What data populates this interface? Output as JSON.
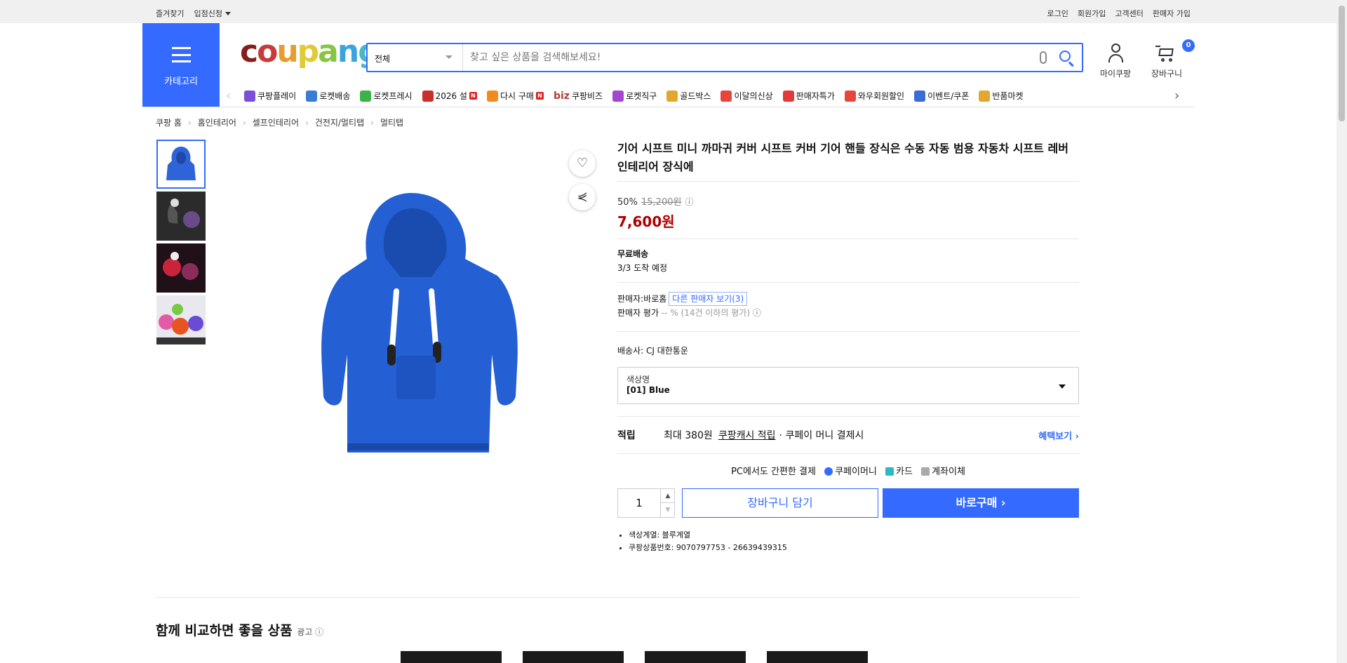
{
  "topbar": {
    "favorites": "즐겨찾기",
    "entry": "입점신청",
    "links": [
      "로그인",
      "회원가입",
      "고객센터",
      "판매자 가입"
    ]
  },
  "category_button": "카테고리",
  "logo": {
    "letters": [
      "c",
      "o",
      "u",
      "p",
      "a",
      "n",
      "g"
    ],
    "colors": [
      "#871d1d",
      "#c73b3b",
      "#e69d2f",
      "#e2ca37",
      "#87c542",
      "#3aa4de",
      "#47b7c9"
    ]
  },
  "search": {
    "category": "전체",
    "placeholder": "찾고 싶은 상품을 검색해보세요!"
  },
  "header_icons": {
    "mypage": "마이쿠팡",
    "cart": "장바구니",
    "cart_count": "0"
  },
  "nav_items": [
    {
      "label": "쿠팡플레이",
      "icon_color": "#7b4fd6"
    },
    {
      "label": "로켓배송",
      "icon_color": "#3a7bd5"
    },
    {
      "label": "로켓프레시",
      "icon_color": "#3cb34a"
    },
    {
      "label": "2026 설",
      "icon_color": "#c9302c",
      "new": "N"
    },
    {
      "label": "다시 구매",
      "icon_color": "#f08c1d",
      "new": "N"
    },
    {
      "label": "쿠팡비즈",
      "icon_color": "#b0403a",
      "prefix": "biz"
    },
    {
      "label": "로켓직구",
      "icon_color": "#a347d1"
    },
    {
      "label": "골드박스",
      "icon_color": "#e2a72e"
    },
    {
      "label": "이달의신상",
      "icon_color": "#e8463a"
    },
    {
      "label": "판매자특가",
      "icon_color": "#e23a3a"
    },
    {
      "label": "와우회원할인",
      "icon_color": "#e8463a"
    },
    {
      "label": "이벤트/쿠폰",
      "icon_color": "#3a6ed6"
    },
    {
      "label": "반품마켓",
      "icon_color": "#e2a72e"
    }
  ],
  "breadcrumb": [
    "쿠팡 홈",
    "홈인테리어",
    "셀프인테리어",
    "건전지/멀티탭",
    "멀티탭"
  ],
  "product": {
    "title": "기어 시프트 미니 까마귀 커버 시프트 커버 기어 핸들 장식은 수동 자동 범용 자동차 시프트 레버 인테리어 장식에",
    "discount": "50%",
    "original_price": "15,200원",
    "sale_price": "7,600원",
    "shipping_title": "무료배송",
    "arrival": "3/3 도착 예정",
    "seller_label": "판매자:",
    "seller": "바로홈",
    "other_sellers": "다른 판매자 보기(3)",
    "rating_label": "판매자 평가",
    "rating_text": "-- % (14건 이하의 평가)",
    "carrier": "배송사:  CJ 대한통운",
    "option_label": "색상명",
    "option_value": "[01] Blue",
    "reward_label": "적립",
    "reward_text": "최대 380원",
    "reward_link": "쿠팡캐시 적립",
    "reward_suffix": "· 쿠페이 머니 결제시",
    "benefit": "혜택보기 ›",
    "pay_title": "PC에서도 간편한 결제",
    "pay_methods": [
      "쿠페이머니",
      "카드",
      "계좌이체"
    ],
    "quantity": "1",
    "add_cart": "장바구니 담기",
    "buy_now": "바로구매 ›",
    "attrs": [
      "색상계열: 블루계열",
      "쿠팡상품번호: 9070797753 - 26639439315"
    ]
  },
  "reco": {
    "title": "함께 비교하면 좋을 상품",
    "ad": "광고 ⓘ"
  }
}
